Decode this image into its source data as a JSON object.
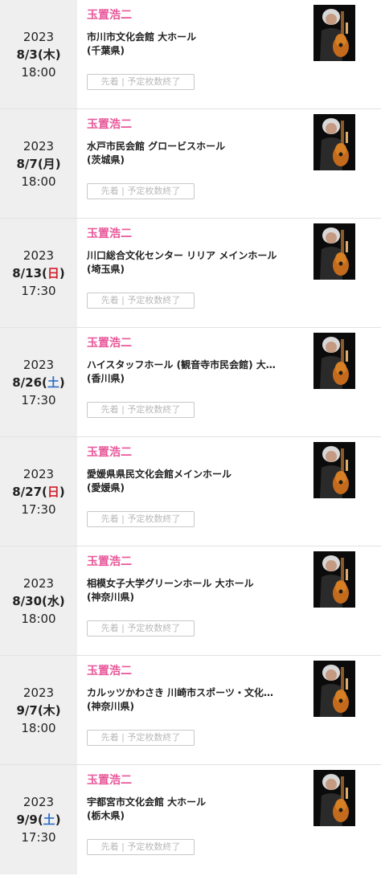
{
  "events": [
    {
      "year": "2023",
      "date": "8/3",
      "dow": "木",
      "dow_type": "weekday",
      "time": "18:00",
      "artist": "玉置浩二",
      "venue": "市川市文化会館 大ホール",
      "pref": "(千葉県)",
      "status": "先着 | 予定枚数終了",
      "thumb_icon": "artist-photo"
    },
    {
      "year": "2023",
      "date": "8/7",
      "dow": "月",
      "dow_type": "weekday",
      "time": "18:00",
      "artist": "玉置浩二",
      "venue": "水戸市民会館 グロービスホール",
      "pref": "(茨城県)",
      "status": "先着 | 予定枚数終了",
      "thumb_icon": "artist-photo"
    },
    {
      "year": "2023",
      "date": "8/13",
      "dow": "日",
      "dow_type": "sun",
      "time": "17:30",
      "artist": "玉置浩二",
      "venue": "川口総合文化センター リリア メインホール",
      "pref": "(埼玉県)",
      "status": "先着 | 予定枚数終了",
      "thumb_icon": "artist-photo"
    },
    {
      "year": "2023",
      "date": "8/26",
      "dow": "土",
      "dow_type": "sat",
      "time": "17:30",
      "artist": "玉置浩二",
      "venue": "ハイスタッフホール (観音寺市民会館) 大…",
      "pref": "(香川県)",
      "status": "先着 | 予定枚数終了",
      "thumb_icon": "artist-photo"
    },
    {
      "year": "2023",
      "date": "8/27",
      "dow": "日",
      "dow_type": "sun",
      "time": "17:30",
      "artist": "玉置浩二",
      "venue": "愛媛県県民文化会館メインホール",
      "pref": "(愛媛県)",
      "status": "先着 | 予定枚数終了",
      "thumb_icon": "artist-photo"
    },
    {
      "year": "2023",
      "date": "8/30",
      "dow": "水",
      "dow_type": "weekday",
      "time": "18:00",
      "artist": "玉置浩二",
      "venue": "相模女子大学グリーンホール 大ホール",
      "pref": "(神奈川県)",
      "status": "先着 | 予定枚数終了",
      "thumb_icon": "artist-photo"
    },
    {
      "year": "2023",
      "date": "9/7",
      "dow": "木",
      "dow_type": "weekday",
      "time": "18:00",
      "artist": "玉置浩二",
      "venue": "カルッツかわさき 川崎市スポーツ・文化…",
      "pref": "(神奈川県)",
      "status": "先着 | 予定枚数終了",
      "thumb_icon": "artist-photo"
    },
    {
      "year": "2023",
      "date": "9/9",
      "dow": "土",
      "dow_type": "sat",
      "time": "17:30",
      "artist": "玉置浩二",
      "venue": "宇都宮市文化会館 大ホール",
      "pref": "(栃木県)",
      "status": "先着 | 予定枚数終了",
      "thumb_icon": "artist-photo"
    }
  ],
  "colors": {
    "artist": "#e8579a",
    "sunday": "#d0202a",
    "saturday": "#2f6fc8",
    "date_bg": "#efefef"
  }
}
